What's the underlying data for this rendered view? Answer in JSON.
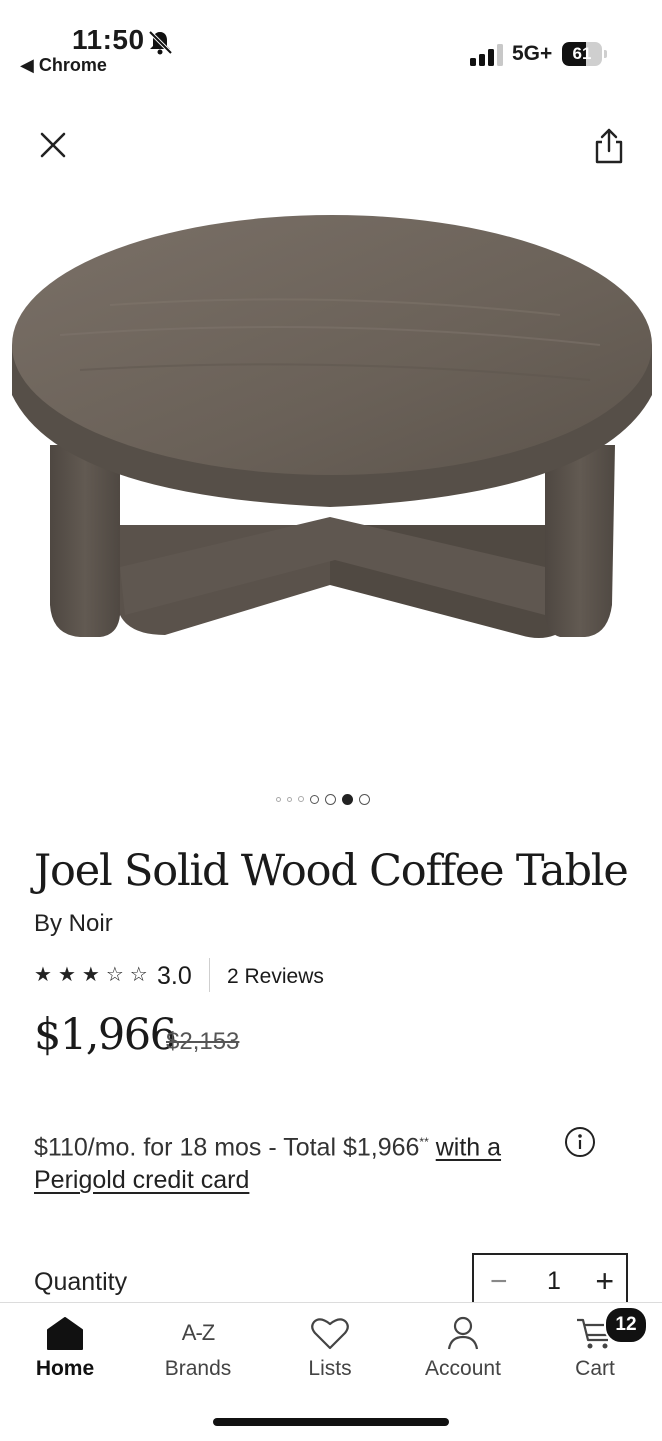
{
  "status_bar": {
    "time": "11:50",
    "back_app": "◀ Chrome",
    "network": "5G+",
    "battery": "61",
    "battery_level": 0.61
  },
  "icons": {
    "close": "close-icon",
    "share": "share-icon",
    "info": "info-icon"
  },
  "gallery": {
    "image_count": 7,
    "active_index": 5
  },
  "product": {
    "title": "Joel Solid Wood Coffee Table",
    "byline": "By Noir",
    "rating_value": "3.0",
    "rating_stars": 3,
    "rating_max": 5,
    "reviews_label": "2 Reviews",
    "price": "$1,966",
    "original_price": "$2,153"
  },
  "financing": {
    "text": "$110/mo. for 18 mos - Total $1,966",
    "footnote_mark": "**",
    "link_text": "with a Perigold credit card"
  },
  "quantity": {
    "label": "Quantity",
    "value": "1",
    "minus": "−",
    "plus": "+"
  },
  "bottom_nav": {
    "items": [
      {
        "label": "Home",
        "icon": "home-icon",
        "active": true
      },
      {
        "label": "Brands",
        "icon": "az-icon",
        "active": false
      },
      {
        "label": "Lists",
        "icon": "heart-icon",
        "active": false
      },
      {
        "label": "Account",
        "icon": "person-icon",
        "active": false
      },
      {
        "label": "Cart",
        "icon": "cart-icon",
        "active": false
      }
    ],
    "brands_icon_text": "A-Z",
    "cart_count": "12"
  },
  "colors": {
    "text": "#1a1a1a",
    "wood_top": "#6b6259",
    "wood_side": "#57504a",
    "badge": "#111111"
  }
}
